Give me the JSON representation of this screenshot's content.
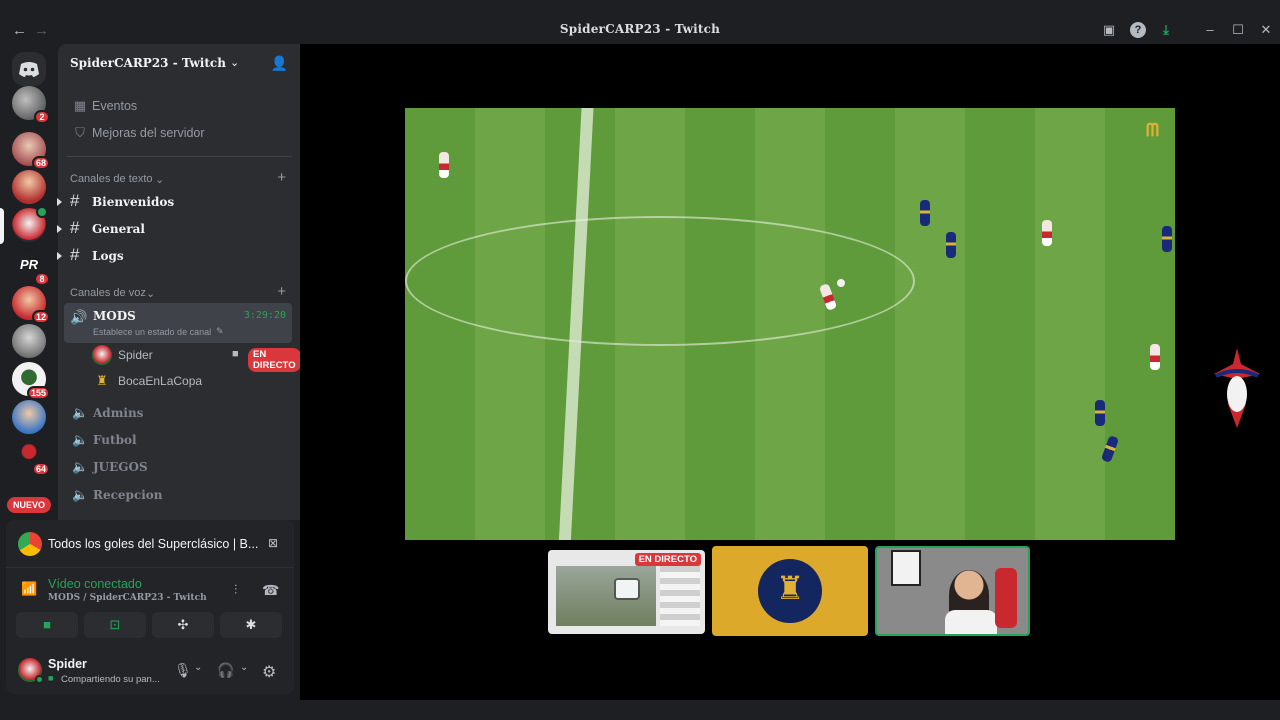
{
  "window": {
    "title": "SpiderCARP23 - Twitch"
  },
  "servers": {
    "badges": [
      "2",
      "68",
      "8",
      "12",
      "155",
      "64"
    ],
    "new_label": "NUEVO"
  },
  "guild": {
    "name": "SpiderCARP23 - Twitch"
  },
  "sidebar": {
    "events_label": "Eventos",
    "boosts_label": "Mejoras del servidor",
    "text_category": "Canales de texto",
    "text_channels": [
      "Bienvenidos",
      "General",
      "Logs"
    ],
    "voice_category": "Canales de voz",
    "active_voice": {
      "name": "MODS",
      "timer": "3:29:20",
      "status_hint": "Establece un estado de canal"
    },
    "voice_users": [
      {
        "name": "Spider",
        "live": "EN DIRECTO"
      },
      {
        "name": "BocaEnLaCopa"
      }
    ],
    "voice_channels": [
      "Admins",
      "Futbol",
      "JUEGOS",
      "Recepcion"
    ]
  },
  "panel": {
    "activity_title": "Todos los goles del Superclásico | B...",
    "voice_status": "Vídeo conectado",
    "voice_location": "MODS / SpiderCARP23 - Twitch",
    "user_name": "Spider",
    "user_status": "Compartiendo su pan..."
  },
  "stage": {
    "thumb_live_label": "EN DIRECTO"
  },
  "colors": {
    "accent_green": "#23a55a",
    "live_red": "#da373c",
    "sidebar_bg": "#2b2d31",
    "app_bg": "#1e1f22"
  }
}
